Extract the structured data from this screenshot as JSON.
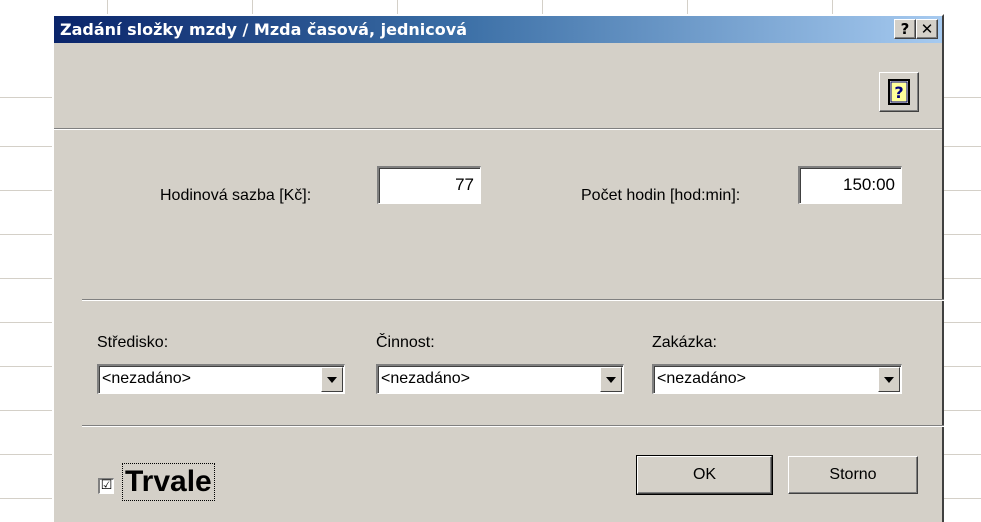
{
  "window": {
    "title": "Zadání složky mzdy / Mzda časová, jednicová",
    "help_caption": "?",
    "close_caption": "✕"
  },
  "toolbar": {
    "help_glyph": "?"
  },
  "form": {
    "hourly_rate_label": "Hodinová sazba [Kč]:",
    "hourly_rate_value": "77",
    "hours_label": "Počet hodin [hod:min]:",
    "hours_value": "150:00"
  },
  "assignment": {
    "center_label": "Středisko:",
    "center_value": "<nezadáno>",
    "activity_label": "Činnost:",
    "activity_value": "<nezadáno>",
    "order_label": "Zakázka:",
    "order_value": "<nezadáno>"
  },
  "footer": {
    "permanent_check": "☑",
    "permanent_label": "Trvale",
    "ok_label": "OK",
    "cancel_label": "Storno"
  },
  "colors": {
    "title_gradient_start": "#0a246a",
    "title_gradient_end": "#a6caf0",
    "dialog_face": "#d4d0c8"
  }
}
